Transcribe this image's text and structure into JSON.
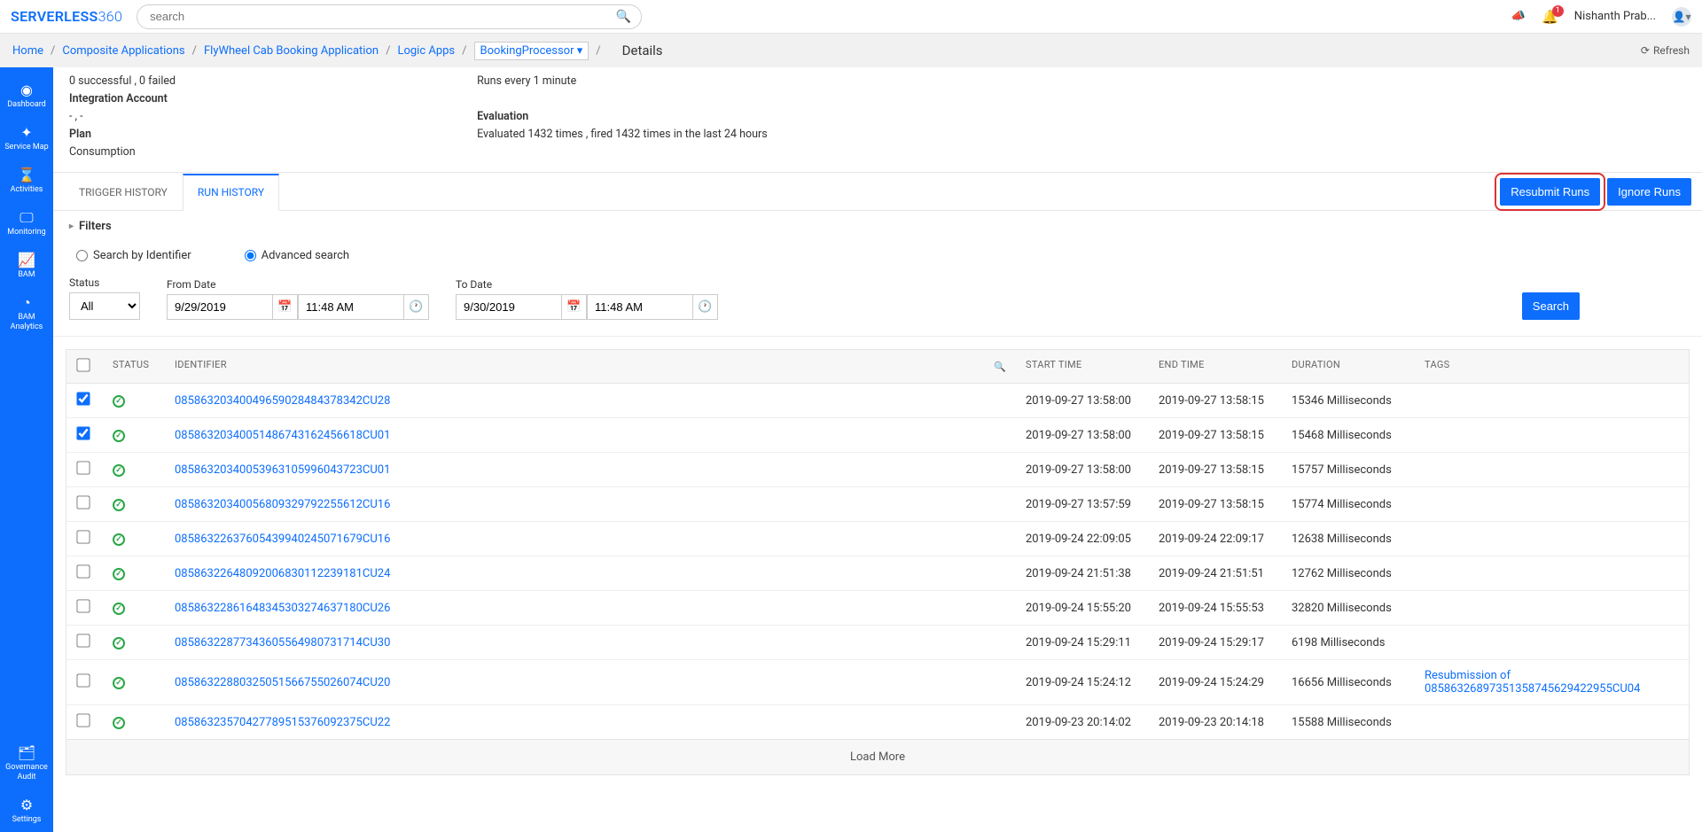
{
  "logo": {
    "brand1": "SERVERLESS",
    "brand2": "360"
  },
  "search": {
    "placeholder": "search"
  },
  "topbar": {
    "notification_count": "1",
    "user": "Nishanth Prab..."
  },
  "breadcrumb": {
    "items": [
      "Home",
      "Composite Applications",
      "FlyWheel Cab Booking Application",
      "Logic Apps"
    ],
    "selector": "BookingProcessor ▾",
    "current": "Details",
    "refresh": "Refresh"
  },
  "sidebar": {
    "items": [
      {
        "label": "Dashboard",
        "icon": "◉"
      },
      {
        "label": "Service Map",
        "icon": "✦"
      },
      {
        "label": "Activities",
        "icon": "⌛"
      },
      {
        "label": "Monitoring",
        "icon": "🖵"
      },
      {
        "label": "BAM",
        "icon": "📈"
      },
      {
        "label": "BAM Analytics",
        "icon": "◔"
      }
    ],
    "bottom": [
      {
        "label": "Governance Audit",
        "icon": "🗂"
      },
      {
        "label": "Settings",
        "icon": "⚙"
      }
    ]
  },
  "summary": {
    "left": {
      "success": "0 successful , 0 failed",
      "integration_label": "Integration Account",
      "integration_value": "- , -",
      "plan_label": "Plan",
      "plan_value": "Consumption"
    },
    "right": {
      "runs_every": "Runs every 1 minute",
      "eval_label": "Evaluation",
      "eval_value": "Evaluated 1432 times , fired 1432 times in the last 24 hours"
    }
  },
  "tabs": {
    "trigger": "TRIGGER HISTORY",
    "run": "RUN HISTORY"
  },
  "actions": {
    "resubmit": "Resubmit Runs",
    "ignore": "Ignore Runs"
  },
  "filters": {
    "header": "Filters",
    "radio_search": "Search by Identifier",
    "radio_adv": "Advanced search",
    "status_label": "Status",
    "status_value": "All",
    "from_label": "From Date",
    "from_date": "9/29/2019",
    "from_time": "11:48 AM",
    "to_label": "To Date",
    "to_date": "9/30/2019",
    "to_time": "11:48 AM",
    "search_btn": "Search"
  },
  "table": {
    "headers": {
      "status": "STATUS",
      "identifier": "IDENTIFIER",
      "start": "START TIME",
      "end": "END TIME",
      "duration": "DURATION",
      "tags": "TAGS"
    },
    "rows": [
      {
        "checked": true,
        "id": "08586320340049659028484378342CU28",
        "start": "2019-09-27 13:58:00",
        "end": "2019-09-27 13:58:15",
        "duration": "15346 Milliseconds",
        "tags": ""
      },
      {
        "checked": true,
        "id": "08586320340051486743162456618CU01",
        "start": "2019-09-27 13:58:00",
        "end": "2019-09-27 13:58:15",
        "duration": "15468 Milliseconds",
        "tags": ""
      },
      {
        "checked": false,
        "id": "08586320340053963105996043723CU01",
        "start": "2019-09-27 13:58:00",
        "end": "2019-09-27 13:58:15",
        "duration": "15757 Milliseconds",
        "tags": ""
      },
      {
        "checked": false,
        "id": "08586320340056809329792255612CU16",
        "start": "2019-09-27 13:57:59",
        "end": "2019-09-27 13:58:15",
        "duration": "15774 Milliseconds",
        "tags": ""
      },
      {
        "checked": false,
        "id": "08586322637605439940245071679CU16",
        "start": "2019-09-24 22:09:05",
        "end": "2019-09-24 22:09:17",
        "duration": "12638 Milliseconds",
        "tags": ""
      },
      {
        "checked": false,
        "id": "08586322648092006830112239181CU24",
        "start": "2019-09-24 21:51:38",
        "end": "2019-09-24 21:51:51",
        "duration": "12762 Milliseconds",
        "tags": ""
      },
      {
        "checked": false,
        "id": "08586322861648345303274637180CU26",
        "start": "2019-09-24 15:55:20",
        "end": "2019-09-24 15:55:53",
        "duration": "32820 Milliseconds",
        "tags": ""
      },
      {
        "checked": false,
        "id": "08586322877343605564980731714CU30",
        "start": "2019-09-24 15:29:11",
        "end": "2019-09-24 15:29:17",
        "duration": "6198 Milliseconds",
        "tags": ""
      },
      {
        "checked": false,
        "id": "08586322880325051566755026074CU20",
        "start": "2019-09-24 15:24:12",
        "end": "2019-09-24 15:24:29",
        "duration": "16656 Milliseconds",
        "tags": "Resubmission of 08586326897351358745629422955CU04"
      },
      {
        "checked": false,
        "id": "08586323570427789515376092375CU22",
        "start": "2019-09-23 20:14:02",
        "end": "2019-09-23 20:14:18",
        "duration": "15588 Milliseconds",
        "tags": ""
      }
    ],
    "loadmore": "Load More"
  }
}
